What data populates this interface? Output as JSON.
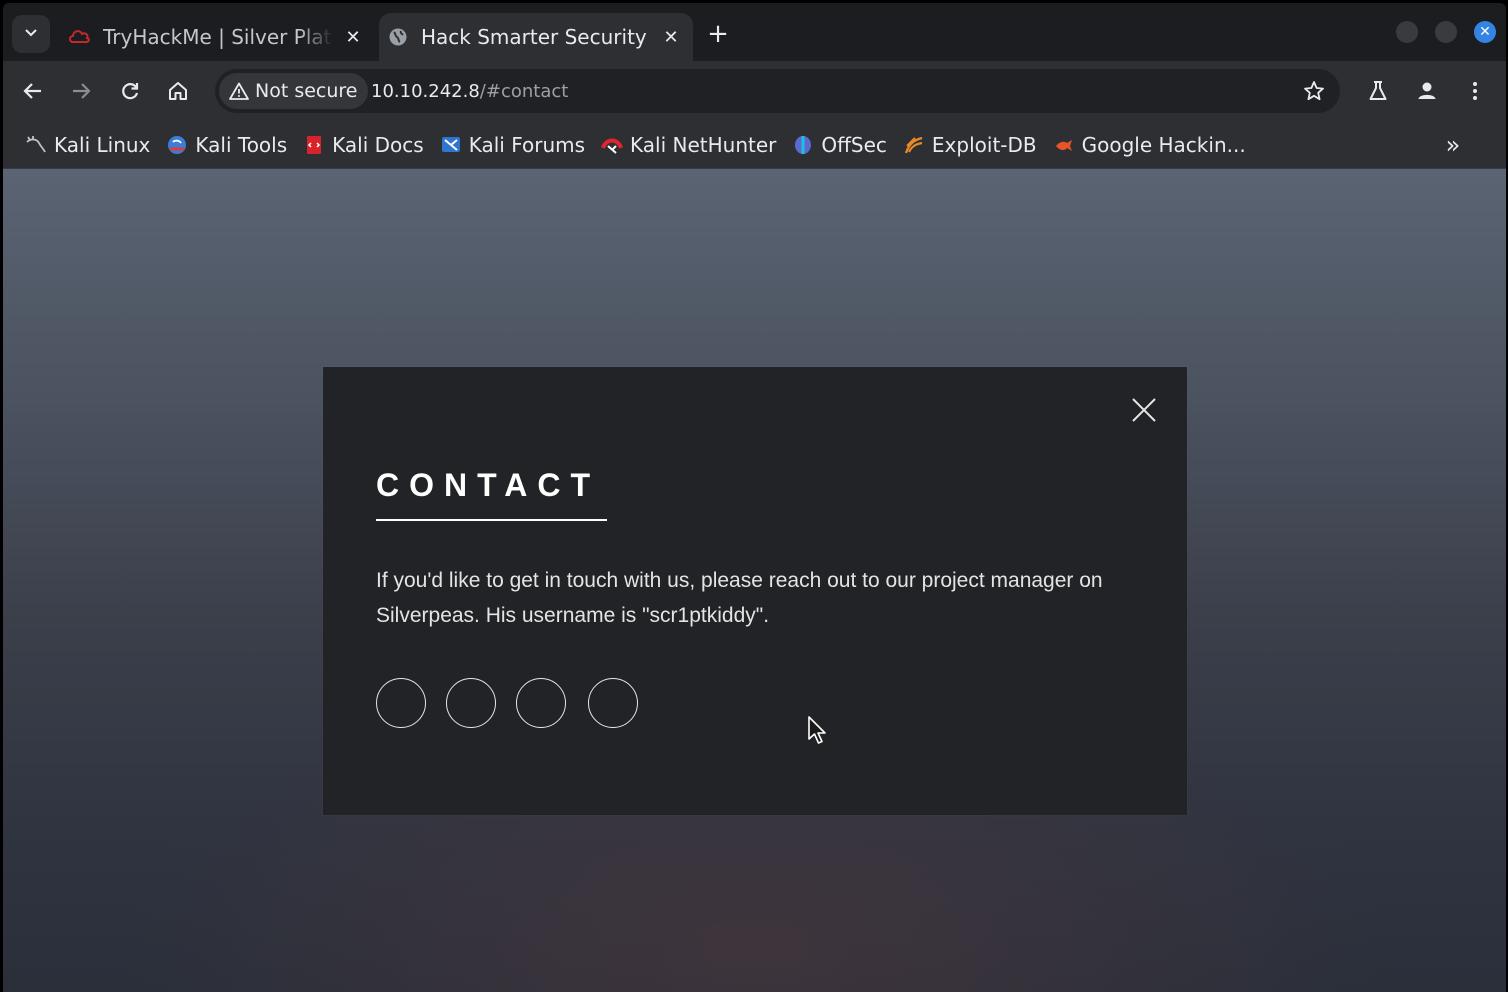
{
  "tabs": [
    {
      "title": "TryHackMe | Silver Platter",
      "icon": "tryhackme-icon",
      "active": false
    },
    {
      "title": "Hack Smarter Security",
      "icon": "globe-icon",
      "active": true
    }
  ],
  "toolbar": {
    "security_label": "Not secure",
    "url_host": "10.10.242.8",
    "url_rest": "/#contact"
  },
  "bookmarks": [
    {
      "label": "Kali Linux",
      "icon": "kali-dragon-icon"
    },
    {
      "label": "Kali Tools",
      "icon": "kali-tools-icon"
    },
    {
      "label": "Kali Docs",
      "icon": "kali-docs-icon"
    },
    {
      "label": "Kali Forums",
      "icon": "kali-forums-icon"
    },
    {
      "label": "Kali NetHunter",
      "icon": "nethunter-icon"
    },
    {
      "label": "OffSec",
      "icon": "offsec-icon"
    },
    {
      "label": "Exploit-DB",
      "icon": "exploit-db-icon"
    },
    {
      "label": "Google Hackin...",
      "icon": "ghdb-icon"
    }
  ],
  "modal": {
    "title": "CONTACT",
    "body": "If you'd like to get in touch with us, please reach out to our project manager on Silverpeas. His username is \"scr1ptkiddy\"."
  },
  "colors": {
    "page_bg_top": "#5a6472",
    "page_bg_bottom": "#2a2f3a",
    "modal_bg": "#222326",
    "accent_blue": "#3584e4"
  }
}
